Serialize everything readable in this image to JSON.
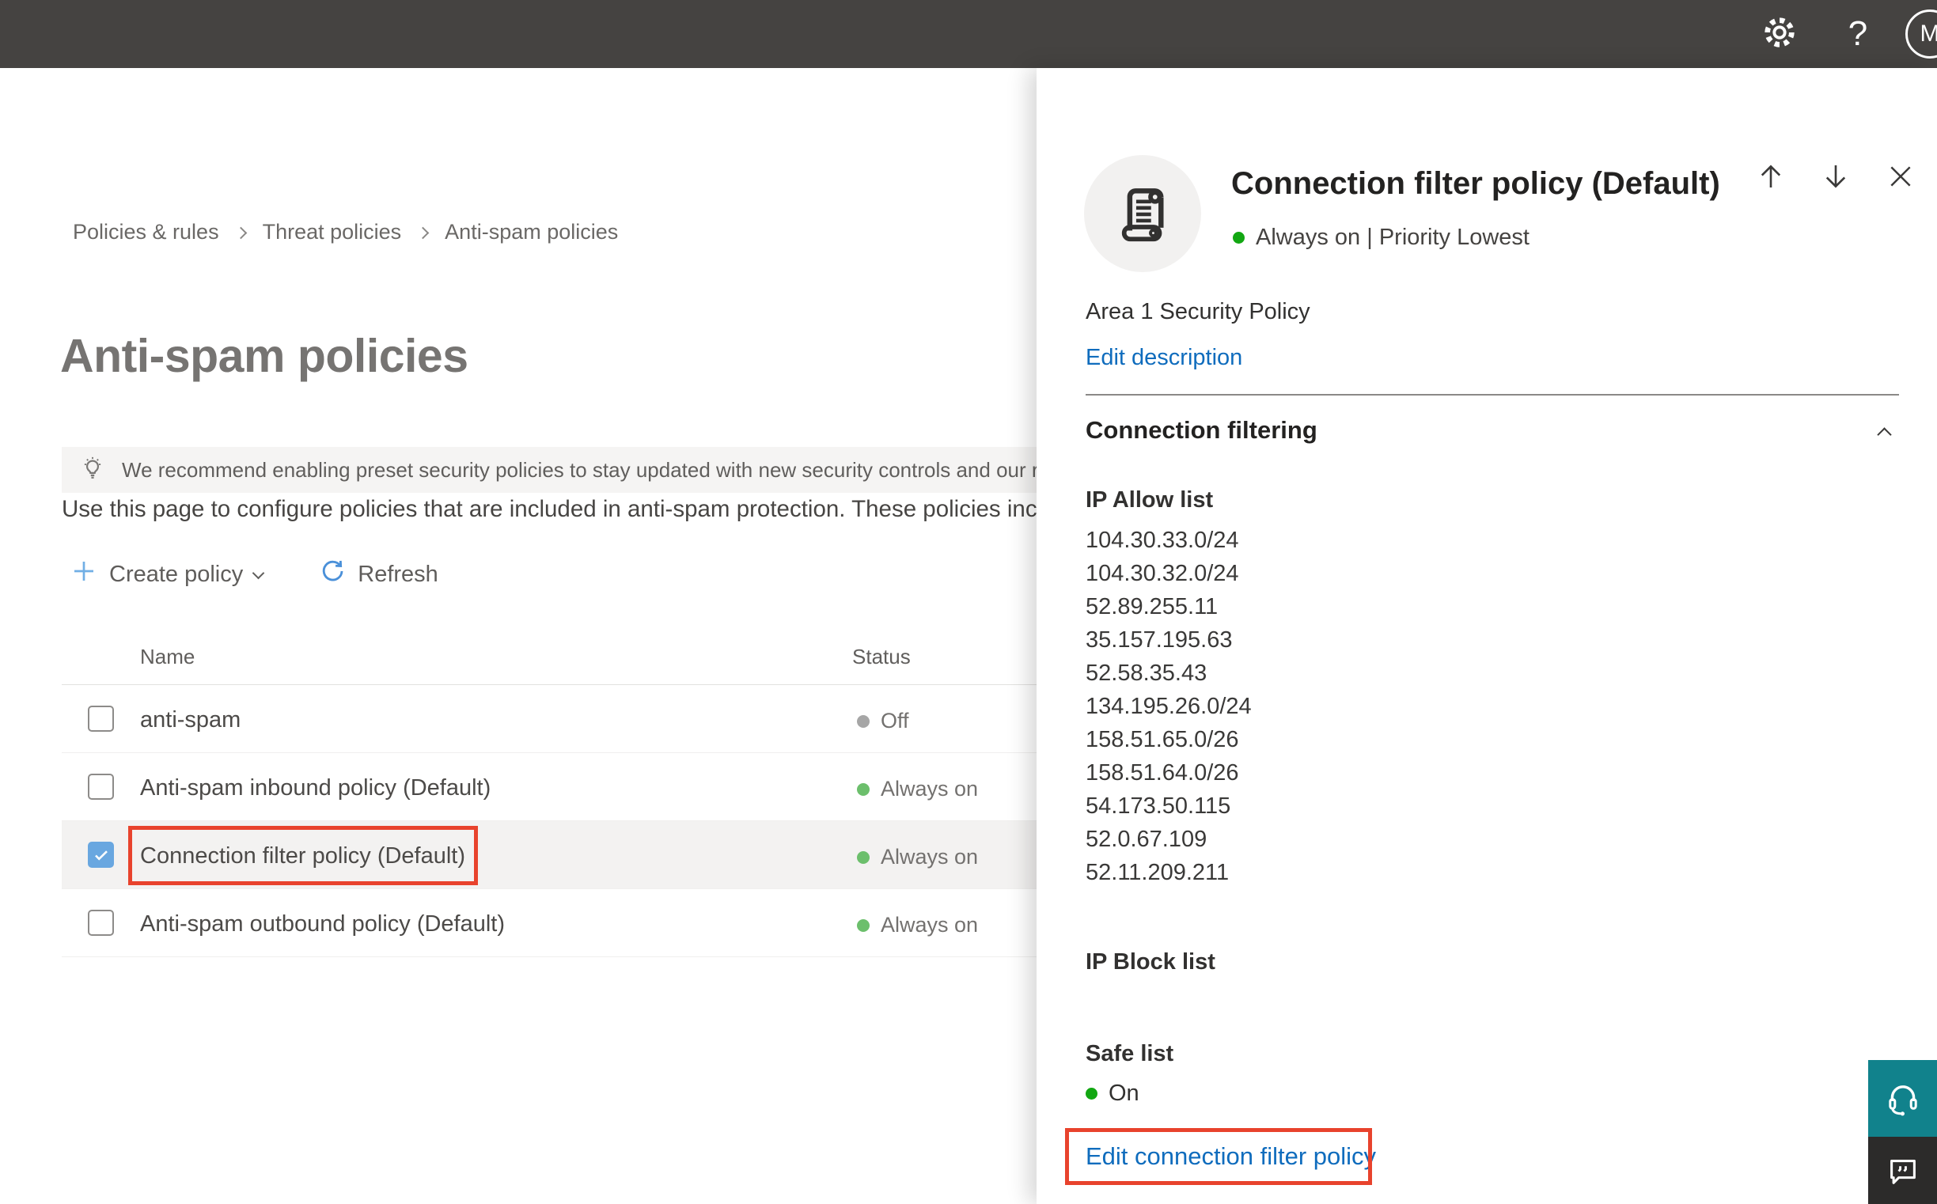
{
  "topbar": {
    "help_glyph": "?",
    "avatar_initial": "M"
  },
  "breadcrumb": [
    "Policies & rules",
    "Threat policies",
    "Anti-spam policies"
  ],
  "page": {
    "title": "Anti-spam policies",
    "banner_text": "We recommend enabling preset security policies to stay updated with new security controls and our recomme",
    "intro_text": "Use this page to configure policies that are included in anti-spam protection. These policies include"
  },
  "toolbar": {
    "create_policy": "Create policy",
    "refresh": "Refresh"
  },
  "table": {
    "columns": {
      "name": "Name",
      "status": "Status"
    },
    "rows": [
      {
        "name": "anti-spam",
        "status": "Off"
      },
      {
        "name": "Anti-spam inbound policy (Default)",
        "status": "Always on"
      },
      {
        "name": "Connection filter policy (Default)",
        "status": "Always on"
      },
      {
        "name": "Anti-spam outbound policy (Default)",
        "status": "Always on"
      }
    ]
  },
  "flyout": {
    "title": "Connection filter policy (Default)",
    "status_line": "Always on | Priority Lowest",
    "description": "Area 1 Security Policy",
    "edit_description_link": "Edit description",
    "section_title": "Connection filtering",
    "ip_allow": {
      "label": "IP Allow list",
      "items": [
        "104.30.33.0/24",
        "104.30.32.0/24",
        "52.89.255.11",
        "35.157.195.63",
        "52.58.35.43",
        "134.195.26.0/24",
        "158.51.65.0/26",
        "158.51.64.0/26",
        "54.173.50.115",
        "52.0.67.109",
        "52.11.209.211"
      ]
    },
    "ip_block": {
      "label": "IP Block list"
    },
    "safe_list": {
      "label": "Safe list",
      "status": "On"
    },
    "edit_link": "Edit connection filter policy"
  },
  "icons": {
    "topbar": [
      "gear-icon",
      "help-icon",
      "avatar"
    ],
    "banner": "lightbulb-icon",
    "toolbar": [
      "plus-icon",
      "chevron-down-icon",
      "refresh-icon"
    ],
    "flyout": [
      "arrow-up-icon",
      "arrow-down-icon",
      "close-icon",
      "scroll-policy-icon",
      "chevron-up-icon"
    ],
    "corner": [
      "headset-icon",
      "feedback-chat-icon"
    ]
  },
  "colors": {
    "topbar_bg": "#454341",
    "accent_blue": "#0f6cbd",
    "checkbox_blue": "#69a7e0",
    "annotation_red": "#e8432d",
    "status_green_soft": "#6cbf6c",
    "status_green_bright": "#12a712",
    "status_gray": "#a6a6a6",
    "support_teal": "#11828c",
    "feedback_dark": "#2c2b2a",
    "banner_bg": "#f5f4f3",
    "selected_row_bg": "#f3f2f1"
  }
}
